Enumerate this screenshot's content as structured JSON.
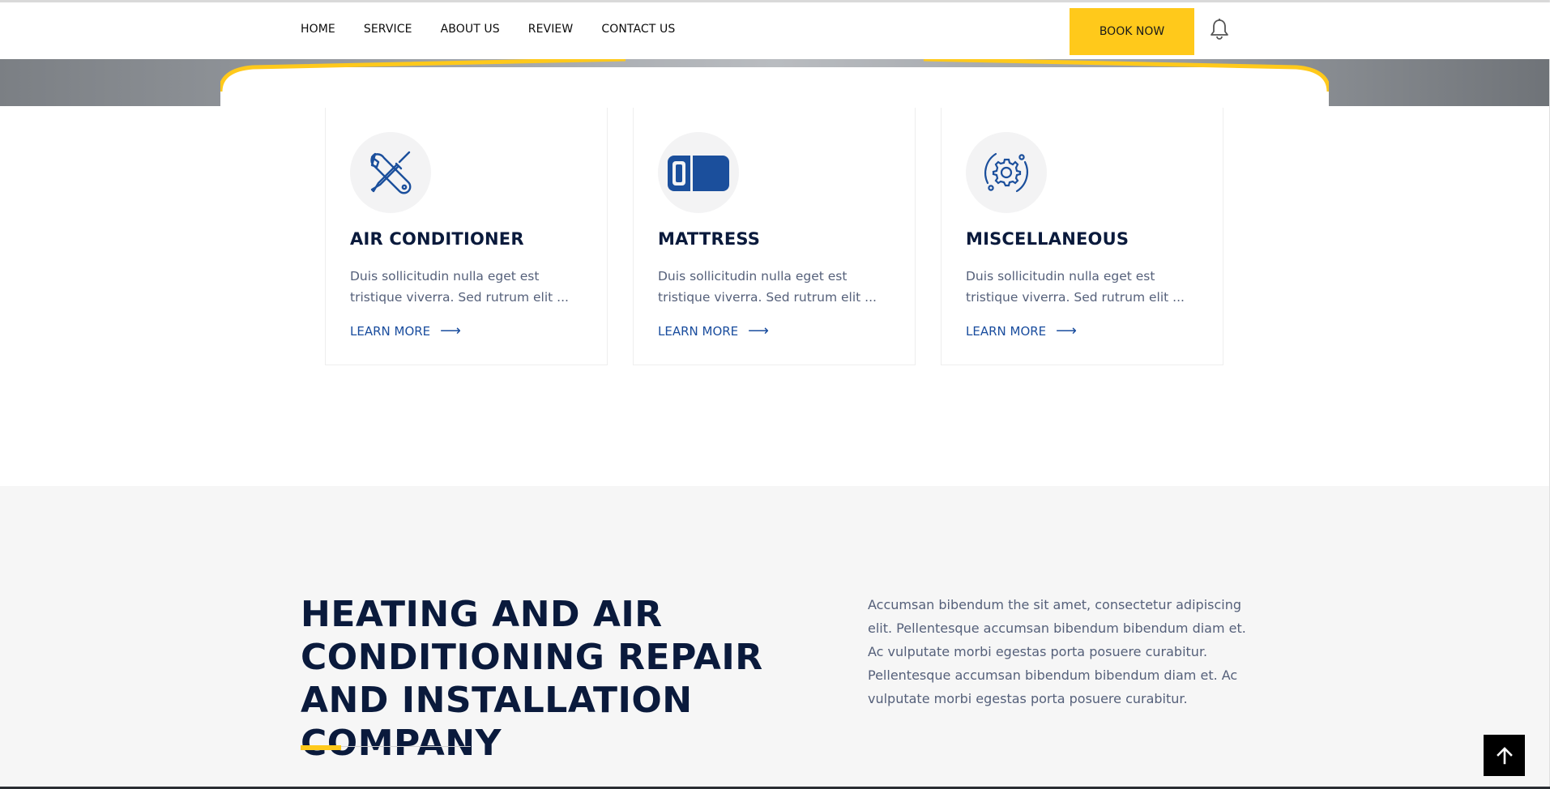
{
  "nav": {
    "items": [
      "HOME",
      "SERVICE",
      "ABOUT US",
      "REVIEW",
      "CONTACT US"
    ],
    "book_label": "BOOK NOW"
  },
  "services": [
    {
      "title": "AIR CONDITIONER",
      "text": "Duis sollicitudin nulla eget est tristique viverra. Sed rutrum elit ...",
      "link": "LEARN MORE",
      "icon": "tools-icon"
    },
    {
      "title": "MATTRESS",
      "text": "Duis sollicitudin nulla eget est tristique viverra. Sed rutrum elit ...",
      "link": "LEARN MORE",
      "icon": "mattress-icon"
    },
    {
      "title": "MISCELLANEOUS",
      "text": "Duis sollicitudin nulla eget est tristique viverra. Sed rutrum elit ...",
      "link": "LEARN MORE",
      "icon": "gear-icon"
    }
  ],
  "about": {
    "title": "HEATING AND AIR CONDITIONING REPAIR AND INSTALLATION COMPANY",
    "text": "Accumsan bibendum the sit amet, consectetur adipiscing elit. Pellentesque accumsan bibendum bibendum diam et. Ac vulputate morbi egestas porta posuere curabitur. Pellentesque accumsan bibendum bibendum diam et. Ac vulputate morbi egestas porta posuere curabitur."
  },
  "colors": {
    "accent": "#ffc91b",
    "navy": "#0a1a3c",
    "link": "#1a4d9e",
    "icon_blue": "#1b4f9c"
  }
}
